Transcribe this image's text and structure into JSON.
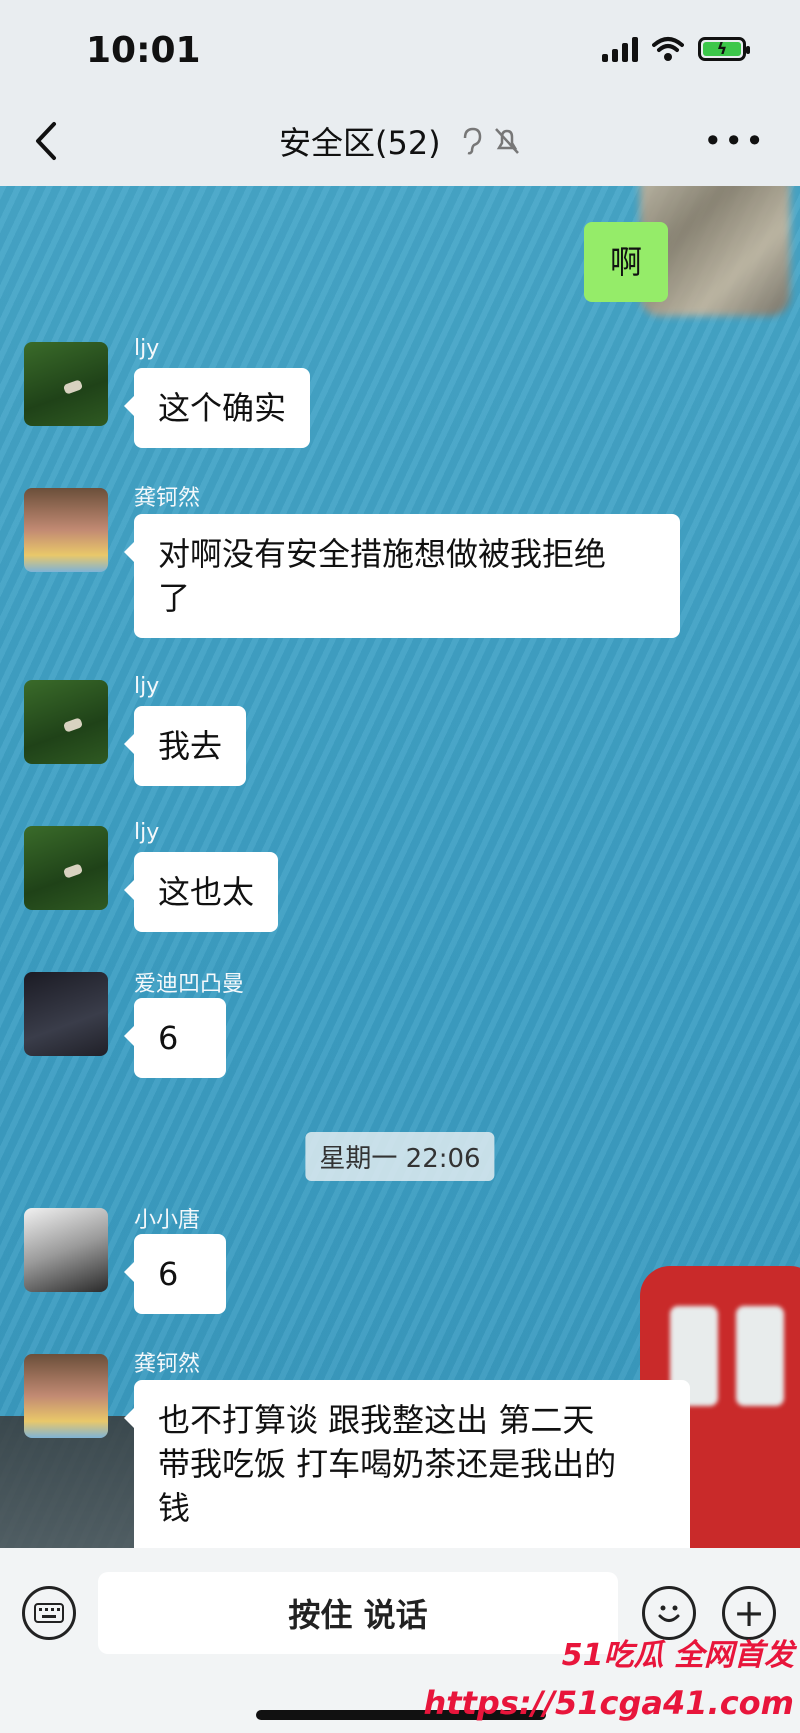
{
  "status": {
    "time": "10:01"
  },
  "header": {
    "title": "安全区(52)"
  },
  "messages": [
    {
      "type": "self",
      "text": "啊"
    },
    {
      "sender": "ljy",
      "text": "这个确实"
    },
    {
      "sender": "龚钶然",
      "text_line1": "对啊没有安全措施想做被我拒绝",
      "text_line2": "了"
    },
    {
      "sender": "ljy",
      "text": "我去"
    },
    {
      "sender": "ljy",
      "text": "这也太"
    },
    {
      "sender": "爱迪凹凸曼",
      "text": "6"
    },
    {
      "timestamp": "星期一 22:06"
    },
    {
      "sender": "小小唐",
      "text": "6"
    },
    {
      "sender": "龚钶然",
      "text_line1": "也不打算谈 跟我整这出 第二天",
      "text_line2": "带我吃饭 打车喝奶茶还是我出的",
      "text_line3": "钱"
    }
  ],
  "input": {
    "hold_to_talk": "按住 说话"
  },
  "watermark": {
    "line1": "51吃瓜 全网首发",
    "line2": "https://51cga41.com"
  },
  "colors": {
    "self_bubble": "#95ec69",
    "chat_bg": "#3fa0c4",
    "watermark": "#e8153b"
  }
}
